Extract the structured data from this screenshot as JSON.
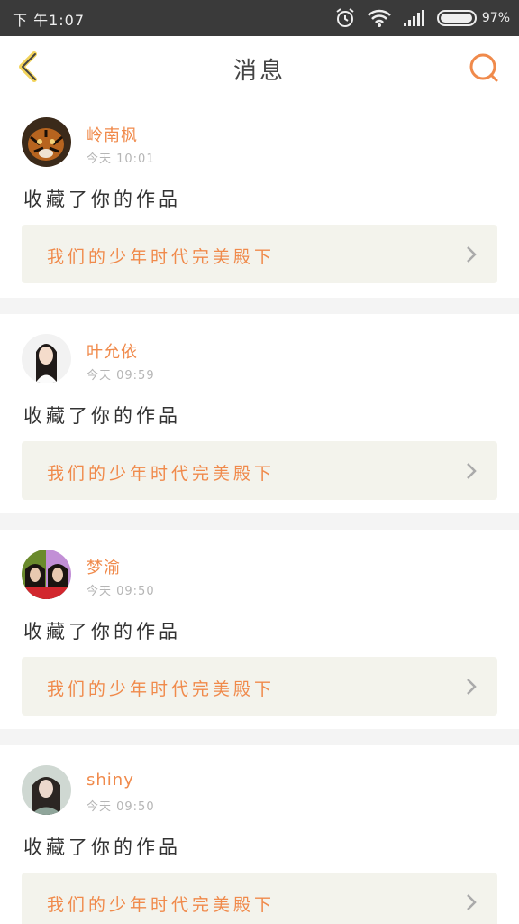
{
  "status_bar": {
    "time": "下 午1:07",
    "battery": "97%",
    "battery_level": 0.97
  },
  "header": {
    "title": "消息",
    "back_icon": "chevron-left-icon",
    "search_icon": "search-icon"
  },
  "colors": {
    "accent": "#f08a4b",
    "back_icon": "#f2d35a",
    "card_bg": "#f3f3ec",
    "status_bar": "#3a3a3a"
  },
  "messages": [
    {
      "name": "岭南枫",
      "time": "今天 10:01",
      "action": "收藏了你的作品",
      "work_title": "我们的少年时代完美殿下"
    },
    {
      "name": "叶允依",
      "time": "今天 09:59",
      "action": "收藏了你的作品",
      "work_title": "我们的少年时代完美殿下"
    },
    {
      "name": "梦渝",
      "time": "今天 09:50",
      "action": "收藏了你的作品",
      "work_title": "我们的少年时代完美殿下"
    },
    {
      "name": "shiny",
      "time": "今天 09:50",
      "action": "收藏了你的作品",
      "work_title": "我们的少年时代完美殿下"
    }
  ]
}
